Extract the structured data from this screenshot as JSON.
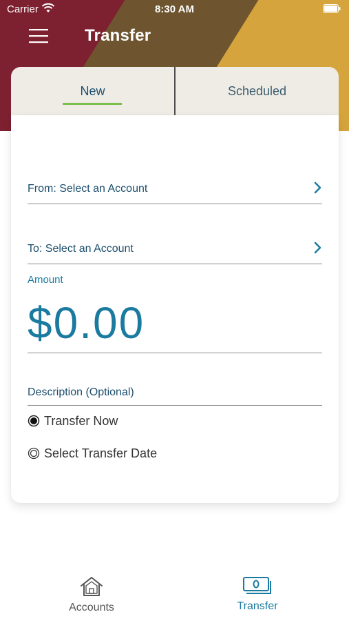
{
  "status_bar": {
    "carrier": "Carrier",
    "time": "8:30 AM"
  },
  "header": {
    "title": "Transfer"
  },
  "tabs": [
    {
      "label": "New",
      "selected": true
    },
    {
      "label": "Scheduled",
      "selected": false
    }
  ],
  "form": {
    "from_label": "From: Select an Account",
    "to_label": "To: Select an Account",
    "amount_label": "Amount",
    "amount_value": "$0.00",
    "description_placeholder": "Description (Optional)",
    "options": [
      {
        "label": "Transfer Now",
        "selected": true
      },
      {
        "label": "Select Transfer Date",
        "selected": false
      }
    ]
  },
  "bottom_nav": [
    {
      "label": "Accounts",
      "icon": "home-icon",
      "active": false
    },
    {
      "label": "Transfer",
      "icon": "money-icon",
      "active": true
    }
  ],
  "colors": {
    "accent": "#1a7aa0",
    "tab_underline": "#7cbf4a",
    "header_maroon": "#7d2030",
    "header_brown": "#6e5530",
    "header_gold": "#d6a43c"
  }
}
